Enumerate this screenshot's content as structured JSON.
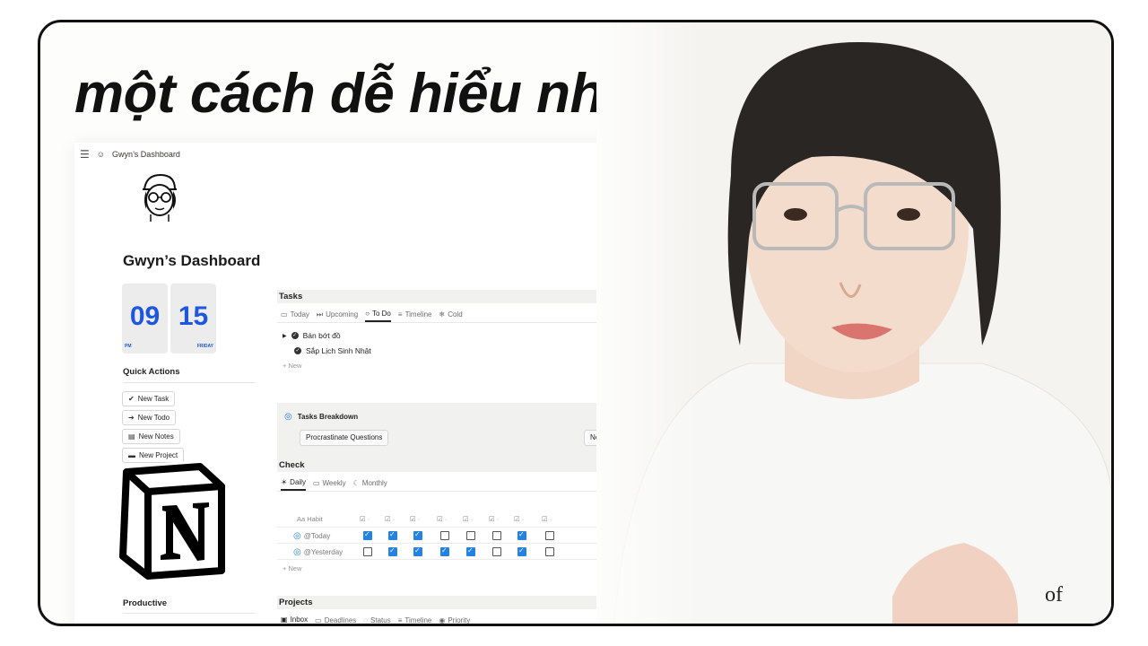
{
  "headline": "một cách dễ hiểu nhất",
  "topbar": {
    "page_name": "Gwyn’s Dashboard"
  },
  "page": {
    "title": "Gwyn’s Dashboard"
  },
  "clock": {
    "hour": "09",
    "minute": "15",
    "ampm": "PM",
    "day": "FRIDAY"
  },
  "quick_actions": {
    "title": "Quick Actions",
    "buttons": [
      "New Task",
      "New Todo",
      "New Notes",
      "New Project"
    ]
  },
  "productive": {
    "title": "Productive"
  },
  "tasks": {
    "title": "Tasks",
    "tabs": [
      "Today",
      "Upcoming",
      "To Do",
      "Timeline",
      "Cold"
    ],
    "active_tab": "To Do",
    "items": [
      "Bán bớt đồ",
      "Sắp Lịch Sinh Nhật"
    ],
    "new_label": "New"
  },
  "breakdown": {
    "title": "Tasks Breakdown",
    "buttons": [
      "Procrastinate Questions",
      "New Break"
    ]
  },
  "check": {
    "title": "Check",
    "tabs": [
      "Daily",
      "Weekly",
      "Monthly"
    ],
    "active_tab": "Daily",
    "column_header": "Aa Habit",
    "rows": [
      {
        "label": "@Today",
        "values": [
          true,
          true,
          true,
          false,
          false,
          false,
          true,
          false
        ]
      },
      {
        "label": "@Yesterday",
        "values": [
          false,
          true,
          true,
          true,
          true,
          false,
          true,
          false
        ]
      }
    ],
    "new_label": "New"
  },
  "projects": {
    "title": "Projects",
    "tabs": [
      "Inbox",
      "Deadlines",
      "Status",
      "Timeline",
      "Priority"
    ],
    "active_tab": "Inbox"
  },
  "colors": {
    "accent": "#2383e2",
    "clock_blue": "#1d56e0"
  },
  "shirt_text": "of"
}
